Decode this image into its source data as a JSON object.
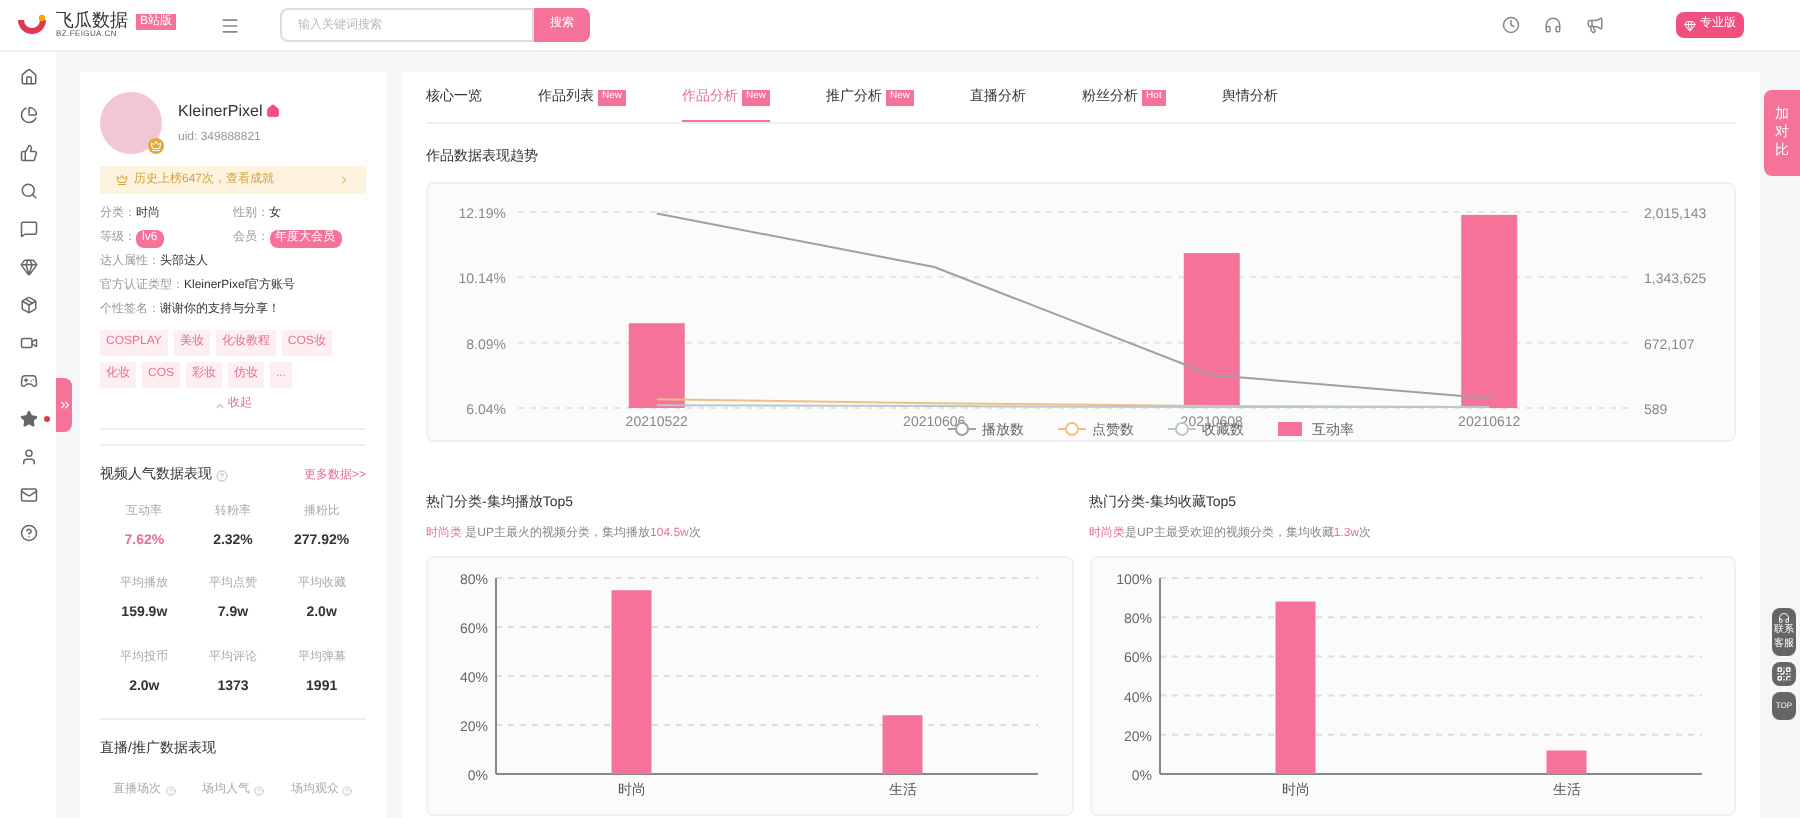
{
  "header": {
    "logo_title": "飞瓜数据",
    "logo_badge": "B站版",
    "logo_url": "BZ.FEIGUA.CN",
    "search": {
      "placeholder": "输入关键词搜索"
    },
    "search_button": "搜索",
    "pro_button": "专业版"
  },
  "profile": {
    "name": "KleinerPixel",
    "uid": "uid: 349888821",
    "ranking_banner": "历史上榜647次，查看成就",
    "fields": [
      {
        "label": "分类：",
        "value": "时尚",
        "kind": "text"
      },
      {
        "label": "性别：",
        "value": "女",
        "kind": "text"
      },
      {
        "label": "等级：",
        "value": "lv6",
        "kind": "badge"
      },
      {
        "label": "会员：",
        "value": "年度大会员",
        "kind": "badge"
      }
    ],
    "details": [
      {
        "label": "达人属性：",
        "value": "头部达人"
      },
      {
        "label": "官方认证类型：",
        "value": "KleinerPixel官方账号"
      },
      {
        "label": "个性签名：",
        "value": "谢谢你的支持与分享！"
      }
    ],
    "tags": [
      "COSPLAY",
      "美妆",
      "化妆教程",
      "COS妆",
      "化妆",
      "COS",
      "彩妆",
      "仿妆",
      "..."
    ],
    "collapse": "收起",
    "stats_title": "视频人气数据表现",
    "more_link": "更多数据>>",
    "stats": [
      {
        "label": "互动率",
        "value": "7.62%",
        "highlight": true
      },
      {
        "label": "转粉率",
        "value": "2.32%",
        "highlight": false
      },
      {
        "label": "播粉比",
        "value": "277.92%",
        "highlight": false
      },
      {
        "label": "平均播放",
        "value": "159.9w",
        "highlight": false
      },
      {
        "label": "平均点赞",
        "value": "7.9w",
        "highlight": false
      },
      {
        "label": "平均收藏",
        "value": "2.0w",
        "highlight": false
      },
      {
        "label": "平均投币",
        "value": "2.0w",
        "highlight": false
      },
      {
        "label": "平均评论",
        "value": "1373",
        "highlight": false
      },
      {
        "label": "平均弹幕",
        "value": "1991",
        "highlight": false
      }
    ],
    "live_title": "直播/推广数据表现",
    "live_stats": [
      "直播场次",
      "场均人气",
      "场均观众"
    ]
  },
  "tabs": [
    {
      "label": "核心一览",
      "selected": false
    },
    {
      "label": "作品列表",
      "badge": "New",
      "selected": false
    },
    {
      "label": "作品分析",
      "badge": "New",
      "selected": true
    },
    {
      "label": "推广分析",
      "badge": "New",
      "selected": false
    },
    {
      "label": "直播分析",
      "selected": false
    },
    {
      "label": "粉丝分析",
      "badge": "Hot",
      "selected": false
    },
    {
      "label": "舆情分析",
      "selected": false
    }
  ],
  "trend": {
    "title": "作品数据表现趋势",
    "chart_data": {
      "type": "bar",
      "categories": [
        "20210522",
        "20210606",
        "20210608",
        "20210612"
      ],
      "series": [
        {
          "name": "播放数",
          "type": "line",
          "axis": "y2",
          "color": "#a0a0a0",
          "values": [
            2000000,
            1450000,
            340000,
            100000
          ]
        },
        {
          "name": "点赞数",
          "type": "line",
          "axis": "y2",
          "color": "#f0c080",
          "values": [
            90000,
            50000,
            20000,
            10000
          ]
        },
        {
          "name": "收藏数",
          "type": "line",
          "axis": "y2",
          "color": "#b8c8d0",
          "values": [
            30000,
            20000,
            10000,
            10000
          ]
        },
        {
          "name": "互动率",
          "type": "bar",
          "color": "#f57399",
          "values": [
            8.7,
            null,
            10.9,
            12.1
          ]
        }
      ],
      "stacked": false,
      "grid": true,
      "legend": "bottom",
      "ylim": [
        6.04,
        12.19
      ],
      "y2lim": [
        589,
        2015143
      ],
      "yticks": [
        {
          "value": 6.04,
          "label": "6.04%"
        },
        {
          "value": 8.09,
          "label": "8.09%"
        },
        {
          "value": 10.14,
          "label": "10.14%"
        },
        {
          "value": 12.19,
          "label": "12.19%"
        }
      ],
      "y2ticks": [
        {
          "value": 589,
          "label": "589"
        },
        {
          "value": 672107,
          "label": "672,107"
        },
        {
          "value": 1343625,
          "label": "1,343,625"
        },
        {
          "value": 2015143,
          "label": "2,015,143"
        }
      ]
    }
  },
  "top5": [
    {
      "title": "热门分类-集均播放Top5",
      "summary": [
        {
          "text": "时尚类",
          "highlight": true
        },
        {
          "text": " 是UP主最火的视频分类，集均播放",
          "highlight": false
        },
        {
          "text": "104.5w",
          "highlight": true
        },
        {
          "text": "次",
          "highlight": false
        }
      ],
      "chart_data": {
        "type": "bar",
        "categories": [
          "时尚",
          "生活"
        ],
        "series": [
          {
            "color": "#f57399",
            "values": [
              75,
              24
            ]
          }
        ],
        "grid": true,
        "ylim": [
          0,
          80
        ],
        "yticks": [
          {
            "value": 0,
            "label": "0%"
          },
          {
            "value": 20,
            "label": "20%"
          },
          {
            "value": 40,
            "label": "40%"
          },
          {
            "value": 60,
            "label": "60%"
          },
          {
            "value": 80,
            "label": "80%"
          }
        ]
      }
    },
    {
      "title": "热门分类-集均收藏Top5",
      "summary": [
        {
          "text": "时尚类",
          "highlight": true
        },
        {
          "text": "是UP主最受欢迎的视频分类，集均收藏",
          "highlight": false
        },
        {
          "text": "1.3w",
          "highlight": true
        },
        {
          "text": "次",
          "highlight": false
        }
      ],
      "chart_data": {
        "type": "bar",
        "categories": [
          "时尚",
          "生活"
        ],
        "series": [
          {
            "color": "#f57399",
            "values": [
              88,
              12
            ]
          }
        ],
        "grid": true,
        "ylim": [
          0,
          100
        ],
        "yticks": [
          {
            "value": 0,
            "label": "0%"
          },
          {
            "value": 20,
            "label": "20%"
          },
          {
            "value": 40,
            "label": "40%"
          },
          {
            "value": 60,
            "label": "60%"
          },
          {
            "value": 80,
            "label": "80%"
          },
          {
            "value": 100,
            "label": "100%"
          }
        ]
      }
    }
  ],
  "side_tools": {
    "compare": "加对比",
    "service": "联系客服",
    "top": "TOP"
  }
}
